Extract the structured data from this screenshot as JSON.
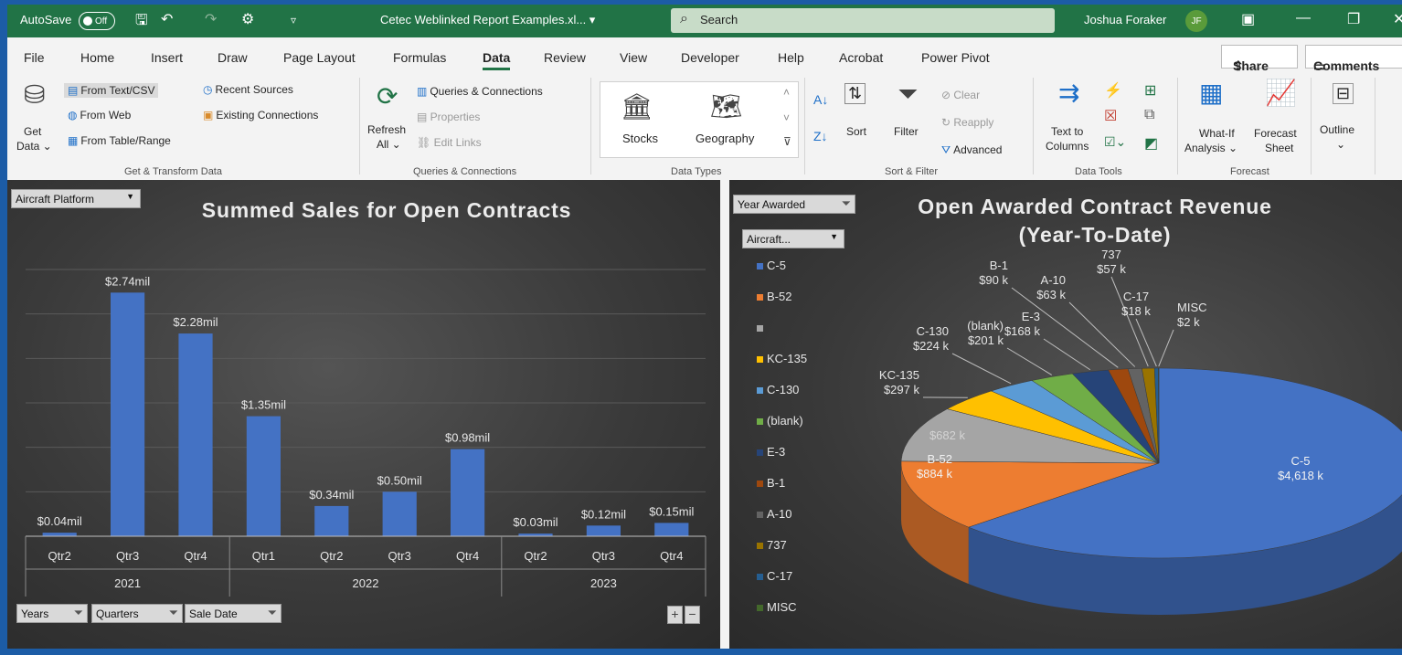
{
  "titlebar": {
    "autosave_label": "AutoSave",
    "autosave_state": "Off",
    "document_title": "Cetec Weblinked Report Examples.xl... ▾",
    "search_placeholder": "Search",
    "user_name": "Joshua Foraker",
    "user_initials": "JF"
  },
  "menu": {
    "items": [
      "File",
      "Home",
      "Insert",
      "Draw",
      "Page Layout",
      "Formulas",
      "Data",
      "Review",
      "View",
      "Developer",
      "Help",
      "Acrobat",
      "Power Pivot"
    ],
    "active": "Data",
    "share_label": "Share",
    "comments_label": "Comments"
  },
  "ribbon": {
    "get_data": {
      "label1": "Get",
      "label2": "Data ⌄",
      "from_text": "From Text/CSV",
      "from_web": "From Web",
      "from_table": "From Table/Range",
      "recent": "Recent Sources",
      "existing": "Existing Connections",
      "group": "Get & Transform Data"
    },
    "queries": {
      "refresh1": "Refresh",
      "refresh2": "All ⌄",
      "queries_conn": "Queries & Connections",
      "properties": "Properties",
      "edit_links": "Edit Links",
      "group": "Queries & Connections"
    },
    "data_types": {
      "stocks": "Stocks",
      "geography": "Geography",
      "group": "Data Types"
    },
    "sort_filter": {
      "sort": "Sort",
      "filter": "Filter",
      "clear": "Clear",
      "reapply": "Reapply",
      "advanced": "Advanced",
      "group": "Sort & Filter"
    },
    "data_tools": {
      "text_to1": "Text to",
      "text_to2": "Columns",
      "group": "Data Tools"
    },
    "forecast": {
      "whatif1": "What-If",
      "whatif2": "Analysis ⌄",
      "fsheet1": "Forecast",
      "fsheet2": "Sheet",
      "group": "Forecast"
    },
    "outline": {
      "label": "Outline",
      "caret": "⌄"
    }
  },
  "bar_panel": {
    "title": "Summed Sales for Open Contracts",
    "filter_slicer": "Aircraft Platform",
    "bottom_slicers": [
      "Years",
      "Quarters",
      "Sale Date"
    ],
    "plus": "+",
    "minus": "−"
  },
  "pie_panel": {
    "title_line1": "Open Awarded Contract Revenue",
    "title_line2": "(Year-To-Date)",
    "slicer_year": "Year Awarded",
    "slicer_aircraft": "Aircraft..."
  },
  "chart_data": [
    {
      "type": "bar",
      "title": "Summed Sales for Open Contracts",
      "categories": [
        "Qtr2",
        "Qtr3",
        "Qtr4",
        "Qtr1",
        "Qtr2",
        "Qtr3",
        "Qtr4",
        "Qtr2",
        "Qtr3",
        "Qtr4"
      ],
      "groups": [
        {
          "label": "2021",
          "count": 3
        },
        {
          "label": "2022",
          "count": 4
        },
        {
          "label": "2023",
          "count": 3
        }
      ],
      "values": [
        0.04,
        2.74,
        2.28,
        1.35,
        0.34,
        0.5,
        0.98,
        0.03,
        0.12,
        0.15
      ],
      "labels": [
        "$0.04mil",
        "$2.74mil",
        "$2.28mil",
        "$1.35mil",
        "$0.34mil",
        "$0.50mil",
        "$0.98mil",
        "$0.03mil",
        "$0.12mil",
        "$0.15mil"
      ],
      "color": "#4472c4",
      "grid": true
    },
    {
      "type": "pie",
      "title": "Open Awarded Contract Revenue (Year-To-Date)",
      "legend": [
        "C-5",
        "B-52",
        "",
        "KC-135",
        "C-130",
        "(blank)",
        "E-3",
        "B-1",
        "A-10",
        "737",
        "C-17",
        "MISC"
      ],
      "legend_position": "left",
      "slices": [
        {
          "name": "C-5",
          "value": 4618,
          "label": "$4,618 k",
          "color": "#4472c4"
        },
        {
          "name": "B-52",
          "value": 884,
          "label": "$884 k",
          "color": "#ed7d31"
        },
        {
          "name": "",
          "value": 682,
          "label": "$682 k",
          "color": "#a5a5a5"
        },
        {
          "name": "KC-135",
          "value": 297,
          "label": "$297 k",
          "color": "#ffc000"
        },
        {
          "name": "C-130",
          "value": 224,
          "label": "$224 k",
          "color": "#5b9bd5"
        },
        {
          "name": "(blank)",
          "value": 201,
          "label": "$201 k",
          "color": "#70ad47"
        },
        {
          "name": "E-3",
          "value": 168,
          "label": "$168 k",
          "color": "#264478"
        },
        {
          "name": "B-1",
          "value": 90,
          "label": "$90 k",
          "color": "#9e480e"
        },
        {
          "name": "A-10",
          "value": 63,
          "label": "$63 k",
          "color": "#636363"
        },
        {
          "name": "737",
          "value": 57,
          "label": "$57 k",
          "color": "#997300"
        },
        {
          "name": "C-17",
          "value": 18,
          "label": "$18 k",
          "color": "#255e91"
        },
        {
          "name": "MISC",
          "value": 2,
          "label": "$2 k",
          "color": "#43682b"
        }
      ]
    }
  ]
}
